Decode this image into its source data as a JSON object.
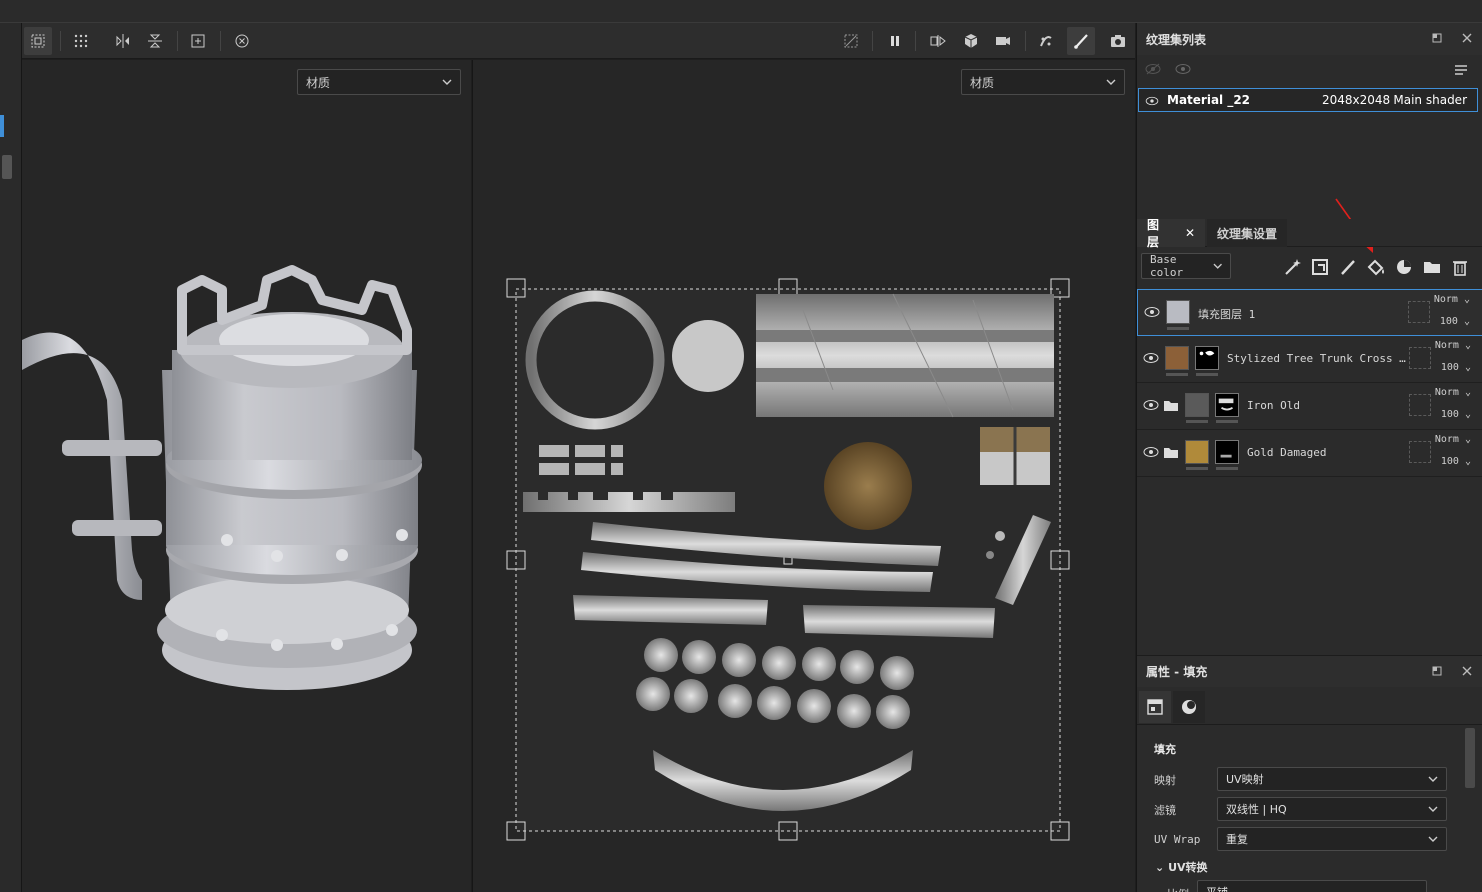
{
  "toolbar": {
    "left_icons": [
      "uv-island-icon",
      "grid-icon",
      "mirror-x-icon",
      "mirror-y-icon",
      "fit-icon",
      "reset-icon"
    ],
    "right_icons": [
      "hide-icon",
      "pause-icon",
      "split-view-icon",
      "cube-icon",
      "camera-icon",
      "symmetry-icon",
      "brush-icon",
      "screenshot-icon"
    ]
  },
  "viewport3d": {
    "material_select": "材质"
  },
  "viewport2d": {
    "material_select": "材质"
  },
  "texture_set_list": {
    "title": "纹理集列表",
    "row": {
      "name": "Material _22",
      "resolution": "2048x2048",
      "shader": "Main shader"
    }
  },
  "layers_panel": {
    "tab_layers": "图层",
    "tab_texture_settings": "纹理集设置",
    "channel_select": "Base color",
    "layers": [
      {
        "name": "填充图层 1",
        "blend": "Norm",
        "opacity": "100"
      },
      {
        "name": "Stylized Tree Trunk Cross …",
        "blend": "Norm",
        "opacity": "100"
      },
      {
        "name": "Iron Old",
        "blend": "Norm",
        "opacity": "100"
      },
      {
        "name": "Gold Damaged",
        "blend": "Norm",
        "opacity": "100"
      }
    ]
  },
  "properties": {
    "title": "属性 - 填充",
    "section": "填充",
    "mapping_label": "映射",
    "mapping_value": "UV映射",
    "filter_label": "滤镜",
    "filter_value": "双线性 | HQ",
    "uvwrap_label": "UV Wrap",
    "uvwrap_value": "重复",
    "uv_transform": "UV转换",
    "scale_label": "比例",
    "scale_value": "平铺"
  },
  "colors": {
    "accent": "#3f8fd8",
    "arrow": "#e0201c"
  }
}
